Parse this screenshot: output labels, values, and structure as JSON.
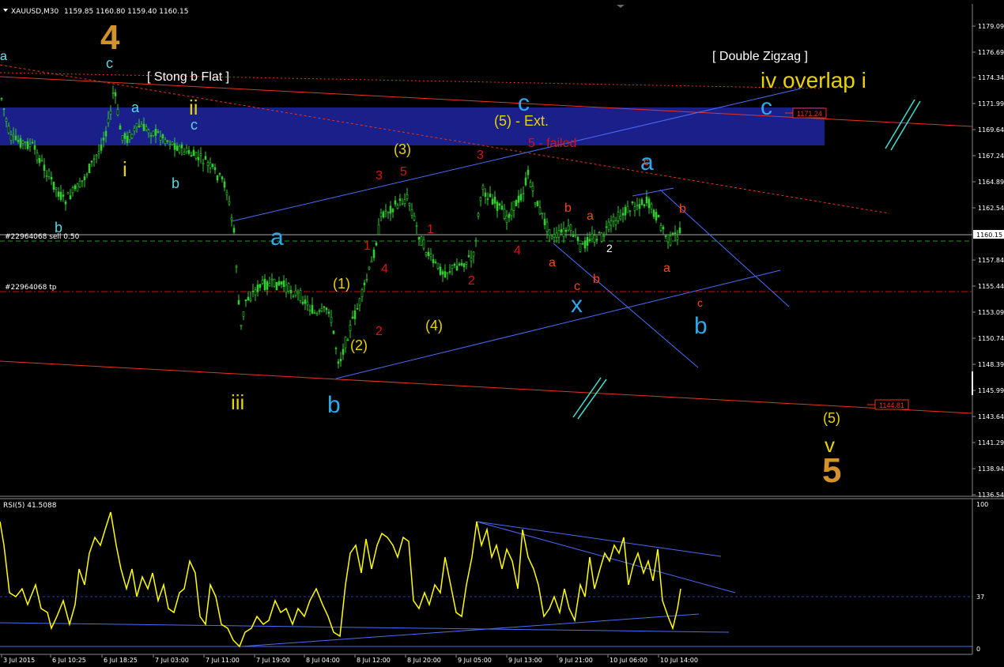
{
  "header": {
    "menu_icon": "triangle-down-icon",
    "symbol": "XAUUSD,M30",
    "ohlc": "1159.85 1160.80 1159.40 1160.15"
  },
  "price_axis": {
    "labels": [
      "1179.09",
      "1176.69",
      "1174.34",
      "1171.99",
      "1169.64",
      "1167.24",
      "1164.89",
      "1162.54",
      "1160.15",
      "1157.84",
      "1155.44",
      "1153.09",
      "1150.74",
      "1148.39",
      "1145.99",
      "1143.64",
      "1141.29",
      "1138.94",
      "1136.54"
    ],
    "current_price": "1160.15"
  },
  "time_axis": {
    "labels": [
      "3 Jul 2015",
      "6 Jul 10:25",
      "6 Jul 18:25",
      "7 Jul 03:00",
      "7 Jul 11:00",
      "7 Jul 19:00",
      "8 Jul 04:00",
      "8 Jul 12:00",
      "8 Jul 20:00",
      "9 Jul 05:00",
      "9 Jul 13:00",
      "9 Jul 21:00",
      "10 Jul 06:00",
      "10 Jul 14:00"
    ]
  },
  "order_lines": {
    "sell_label": "#22964068 sell 0.50",
    "tp_label": "#22964068 tp"
  },
  "price_tags": {
    "upper": "1171.24",
    "lower": "1144.81"
  },
  "annotations": [
    {
      "text": "4",
      "color": "#d4922a",
      "size": 44,
      "weight": "bold"
    },
    {
      "text": "c",
      "color": "#5fd3e0",
      "size": 18
    },
    {
      "text": "[ Stong b Flat ]",
      "color": "#ffffff",
      "size": 16
    },
    {
      "text": "ii",
      "color": "#e8d200",
      "size": 26
    },
    {
      "text": "c",
      "color": "#5fd3e0",
      "size": 18
    },
    {
      "text": "a",
      "color": "#5fd3e0",
      "size": 18
    },
    {
      "text": "a",
      "color": "#5fd3e0",
      "size": 16
    },
    {
      "text": "i",
      "color": "#e8d200",
      "size": 26
    },
    {
      "text": "b",
      "color": "#5fd3e0",
      "size": 18
    },
    {
      "text": "b",
      "color": "#5fd3e0",
      "size": 18
    },
    {
      "text": "iii",
      "color": "#e8d200",
      "size": 26
    },
    {
      "text": "a",
      "color": "#2fa8e8",
      "size": 30
    },
    {
      "text": "b",
      "color": "#2fa8e8",
      "size": 30
    },
    {
      "text": "(1)",
      "color": "#e8d200",
      "size": 18
    },
    {
      "text": "(2)",
      "color": "#e8d200",
      "size": 18
    },
    {
      "text": "(3)",
      "color": "#e8d200",
      "size": 18
    },
    {
      "text": "(4)",
      "color": "#e8d200",
      "size": 18
    },
    {
      "text": "(5) - Ext.",
      "color": "#e8d200",
      "size": 18
    },
    {
      "text": "c",
      "color": "#2fa8e8",
      "size": 30
    },
    {
      "text": "5 - failed",
      "color": "#e01010",
      "size": 16
    },
    {
      "text": "3",
      "color": "#e01010",
      "size": 16
    },
    {
      "text": "5",
      "color": "#e01010",
      "size": 16
    },
    {
      "text": "1",
      "color": "#e01010",
      "size": 16
    },
    {
      "text": "4",
      "color": "#e01010",
      "size": 16
    },
    {
      "text": "2",
      "color": "#e01010",
      "size": 16
    },
    {
      "text": "1",
      "color": "#e01010",
      "size": 16
    },
    {
      "text": "2",
      "color": "#e01010",
      "size": 16
    },
    {
      "text": "3",
      "color": "#e01010",
      "size": 16
    },
    {
      "text": "4",
      "color": "#e01010",
      "size": 16
    },
    {
      "text": "b",
      "color": "#ff4500",
      "size": 16
    },
    {
      "text": "a",
      "color": "#ff4500",
      "size": 16
    },
    {
      "text": "a",
      "color": "#ff4500",
      "size": 16
    },
    {
      "text": "c",
      "color": "#ff4500",
      "size": 16
    },
    {
      "text": "b",
      "color": "#ff4500",
      "size": 16
    },
    {
      "text": "2",
      "color": "#ffffff",
      "size": 14
    },
    {
      "text": "x",
      "color": "#2fa8e8",
      "size": 30
    },
    {
      "text": "a",
      "color": "#2fa8e8",
      "size": 30
    },
    {
      "text": "c",
      "color": "#ff4500",
      "size": 14
    },
    {
      "text": "b",
      "color": "#ff4500",
      "size": 16
    },
    {
      "text": "a",
      "color": "#ff4500",
      "size": 16
    },
    {
      "text": "c",
      "color": "#ff4500",
      "size": 14
    },
    {
      "text": "b",
      "color": "#2fa8e8",
      "size": 30
    },
    {
      "text": "[ Double Zigzag ]",
      "color": "#ffffff",
      "size": 16
    },
    {
      "text": "iv overlap i",
      "color": "#e8d200",
      "size": 28
    },
    {
      "text": "c",
      "color": "#2fa8e8",
      "size": 30
    },
    {
      "text": "(5)",
      "color": "#e8d200",
      "size": 18
    },
    {
      "text": "v",
      "color": "#e8d200",
      "size": 26
    },
    {
      "text": "5",
      "color": "#d4922a",
      "size": 44,
      "weight": "bold"
    },
    {
      "text": "a",
      "color": "#5fd3e0",
      "size": 16
    }
  ],
  "rsi": {
    "label": "RSI(5) 41.5088",
    "levels": [
      "100",
      "37",
      "0"
    ]
  },
  "colors": {
    "background": "#000000",
    "bull_candle": "#32cd32",
    "bear_candle": "#32cd32",
    "zone": "#1a1f8a",
    "rsi_line": "#ffff00",
    "channel": "#4a6cf7",
    "trendline_red": "#e8341a"
  }
}
